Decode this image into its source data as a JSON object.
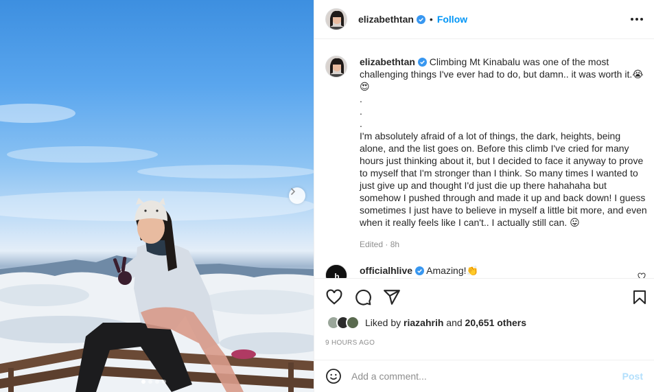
{
  "post": {
    "author": "elizabethtan",
    "follow_label": "Follow",
    "separator": "•",
    "slides": {
      "count": 4,
      "active": 1
    }
  },
  "caption": {
    "author": "elizabethtan",
    "lines": [
      "Climbing Mt Kinabalu was one of the most",
      "challenging things I've ever had to do, but damn.. it was worth it.😭",
      "😍",
      ".",
      ".",
      ".",
      "I'm absolutely afraid of a lot of things, the dark, heights, being",
      "alone, and the list goes on. Before this climb I've cried for many",
      "hours just thinking about it, but I decided to face it anyway to prove",
      "to myself that I'm stronger than I think. So many times I wanted to",
      "just give up and thought I'd just die up there hahahaha but",
      "somehow I pushed through and made it up and back down! I guess",
      "sometimes I just have to believe in myself a little bit more, and even",
      "when it really feels like I can't.. I actually still can. 😛"
    ],
    "meta": "Edited · 8h"
  },
  "comment": {
    "author": "officialhlive",
    "text": "Amazing!👏"
  },
  "likes": {
    "prefix": "Liked by",
    "user": "riazahrih",
    "connector": "and",
    "count": "20,651 others"
  },
  "timestamp": "9 HOURS AGO",
  "add_comment": {
    "placeholder": "Add a comment...",
    "post_label": "Post"
  },
  "colors": {
    "accent": "#0095f6",
    "verified": "#3897f0",
    "post_disabled": "#b2dffc",
    "muted": "#8e8e8e"
  },
  "icons": [
    "chevron-right-icon",
    "more-options-icon",
    "verified-badge-icon",
    "heart-icon",
    "comment-icon",
    "share-icon",
    "bookmark-icon",
    "emoji-icon"
  ]
}
